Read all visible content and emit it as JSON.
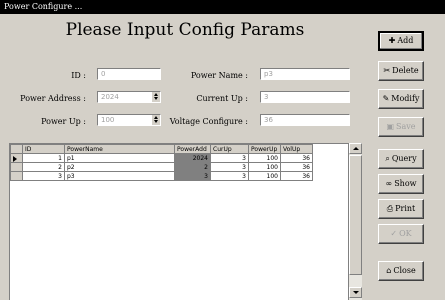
{
  "window": {
    "title": "Power Configure ..."
  },
  "form": {
    "heading": "Please Input Config Params",
    "fields": {
      "id": {
        "label": "ID :",
        "value": "0"
      },
      "power_name": {
        "label": "Power Name :",
        "value": "p3"
      },
      "power_address": {
        "label": "Power Address :",
        "value": "2024"
      },
      "current_up": {
        "label": "Current Up :",
        "value": "3"
      },
      "power_up": {
        "label": "Power Up :",
        "value": "100"
      },
      "voltage_up": {
        "label": "Voltage Configure :",
        "value": "36"
      }
    }
  },
  "grid": {
    "columns": [
      "ID",
      "PowerName",
      "PowerAdd",
      "CurUp",
      "PowerUp",
      "VolUp"
    ],
    "rows": [
      {
        "id": "1",
        "name": "p1",
        "add": "2024",
        "cur": "3",
        "power": "100",
        "vol": "36"
      },
      {
        "id": "2",
        "name": "p2",
        "add": "2",
        "cur": "3",
        "power": "100",
        "vol": "36"
      },
      {
        "id": "3",
        "name": "p3",
        "add": "3",
        "cur": "3",
        "power": "100",
        "vol": "36"
      }
    ]
  },
  "buttons": {
    "add": "Add",
    "delete": "Delete",
    "modify": "Modify",
    "save": "Save",
    "query": "Query",
    "show": "Show",
    "print": "Print",
    "ok": "OK",
    "close": "Close"
  }
}
